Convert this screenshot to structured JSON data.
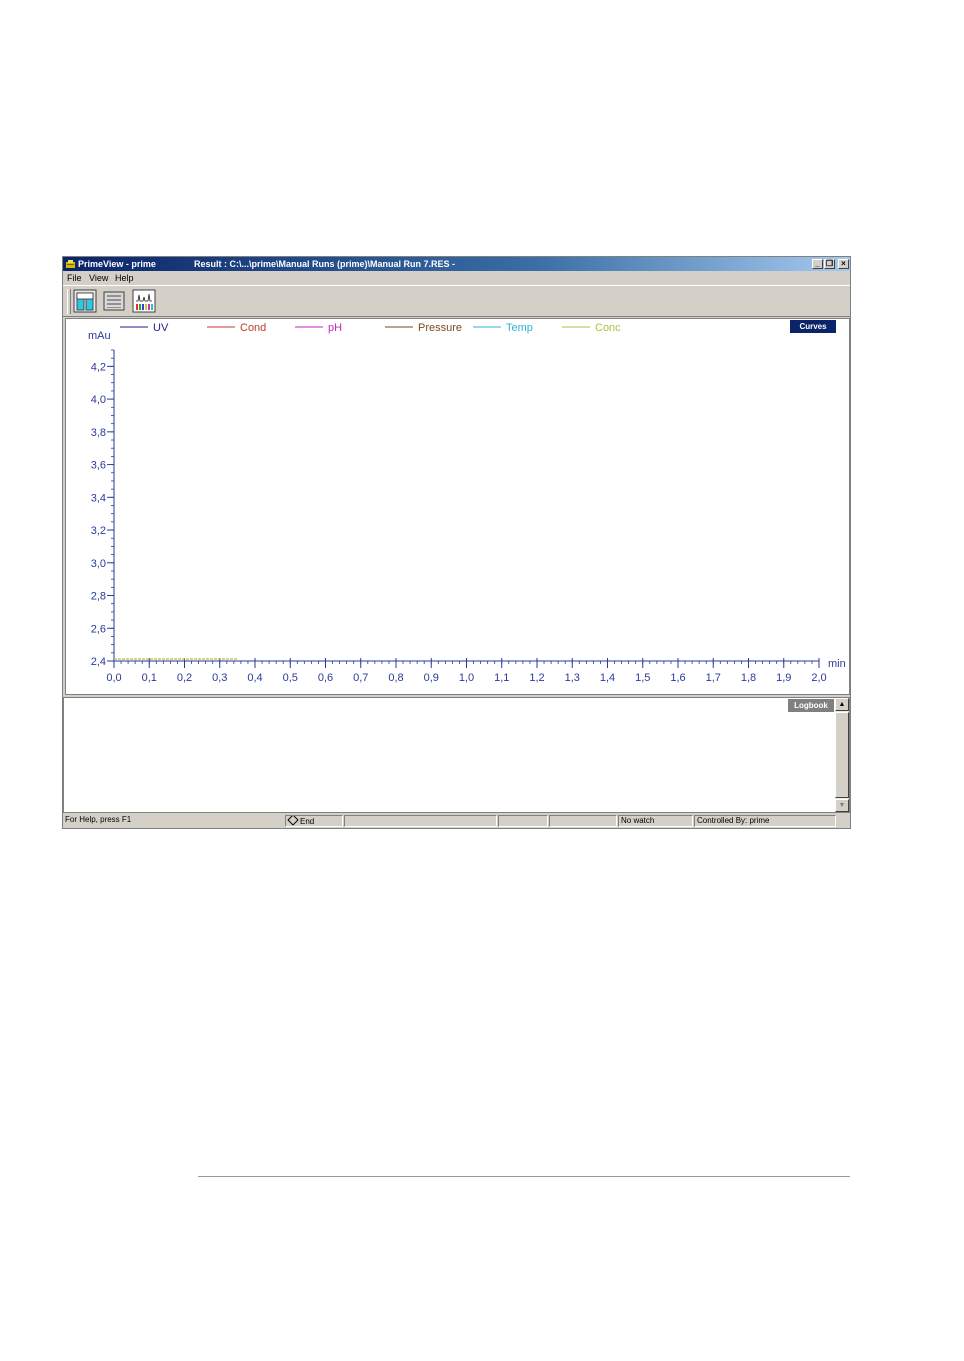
{
  "window": {
    "app_title": "PrimeView - prime",
    "doc_title": "Result : C:\\...\\prime\\Manual Runs (prime)\\Manual Run 7.RES -",
    "btn_min": "_",
    "btn_restore": "❐",
    "btn_close": "×"
  },
  "menu": {
    "file": "File",
    "view": "View",
    "help": "Help"
  },
  "toolbar": {
    "icons": [
      "system-control-icon",
      "method-editor-icon",
      "evaluation-icon"
    ]
  },
  "chart_data": {
    "type": "line",
    "y_unit": "mAu",
    "x_unit": "min",
    "ylim": [
      2.4,
      4.3
    ],
    "xlim": [
      0.0,
      2.0
    ],
    "y_ticks": [
      "2,4",
      "2,6",
      "2,8",
      "3,0",
      "3,2",
      "3,4",
      "3,6",
      "3,8",
      "4,0",
      "4,2"
    ],
    "x_ticks": [
      "0,0",
      "0,1",
      "0,2",
      "0,3",
      "0,4",
      "0,5",
      "0,6",
      "0,7",
      "0,8",
      "0,9",
      "1,0",
      "1,1",
      "1,2",
      "1,3",
      "1,4",
      "1,5",
      "1,6",
      "1,7",
      "1,8",
      "1,9",
      "2,0"
    ],
    "legend": [
      {
        "name": "UV",
        "color": "#1f1f8f"
      },
      {
        "name": "Cond",
        "color": "#c0392b"
      },
      {
        "name": "pH",
        "color": "#c026c0"
      },
      {
        "name": "Pressure",
        "color": "#7a4a1a"
      },
      {
        "name": "Temp",
        "color": "#2bb6d6"
      },
      {
        "name": "Conc",
        "color": "#b0c040"
      }
    ],
    "series": [
      {
        "name": "Conc",
        "x": [
          0.0,
          0.35
        ],
        "y": [
          2.4,
          2.4
        ]
      }
    ],
    "curves_label": "Curves"
  },
  "logbook": {
    "label": "Logbook"
  },
  "statusbar": {
    "help": "For Help, press F1",
    "state": "End",
    "watch": "No watch",
    "controlled_by": "Controlled By: prime"
  }
}
